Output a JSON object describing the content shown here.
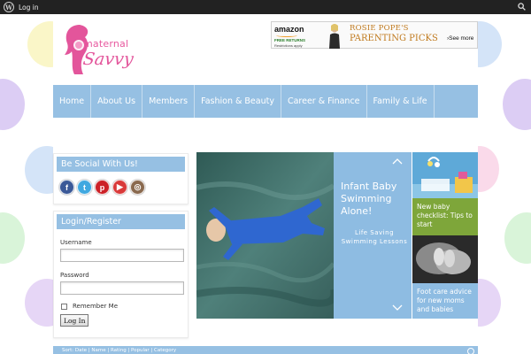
{
  "admin_bar": {
    "login_label": "Log in"
  },
  "logo": {
    "line1": "maternal",
    "line2": "Savvy"
  },
  "banner": {
    "brand": "amazon",
    "free_returns": "FREE RETURNS",
    "restrictions": "Restrictions apply",
    "headline_line1": "ROSIE POPE'S",
    "headline_line2": "PARENTING PICKS",
    "see_more": "›See more"
  },
  "nav": {
    "items": [
      {
        "label": "Home"
      },
      {
        "label": "About Us"
      },
      {
        "label": "Members"
      },
      {
        "label": "Fashion & Beauty"
      },
      {
        "label": "Career & Finance"
      },
      {
        "label": "Family & Life"
      }
    ]
  },
  "social_widget": {
    "title": "Be Social With Us!",
    "icons": [
      "facebook-icon",
      "twitter-icon",
      "pinterest-icon",
      "youtube-icon",
      "instagram-icon"
    ]
  },
  "login_widget": {
    "title": "Login/Register",
    "username_label": "Username",
    "password_label": "Password",
    "remember_label": "Remember Me",
    "login_button": "Log In"
  },
  "slider": {
    "title": "Infant Baby Swimming Alone!",
    "subtitle": "Life Saving Swimming Lessons",
    "thumbs": [
      {
        "caption": "New baby checklist: Tips to start"
      },
      {
        "caption": "Foot care advice for new moms and babies"
      }
    ]
  },
  "bottom_bar": {
    "text": "Sort: Date | Name | Rating | Popular | Category"
  },
  "colors": {
    "accent_blue": "#96c0e3",
    "brand_pink": "#e3559b",
    "admin_bar": "#222222",
    "thumb_green": "#7ea63a"
  }
}
